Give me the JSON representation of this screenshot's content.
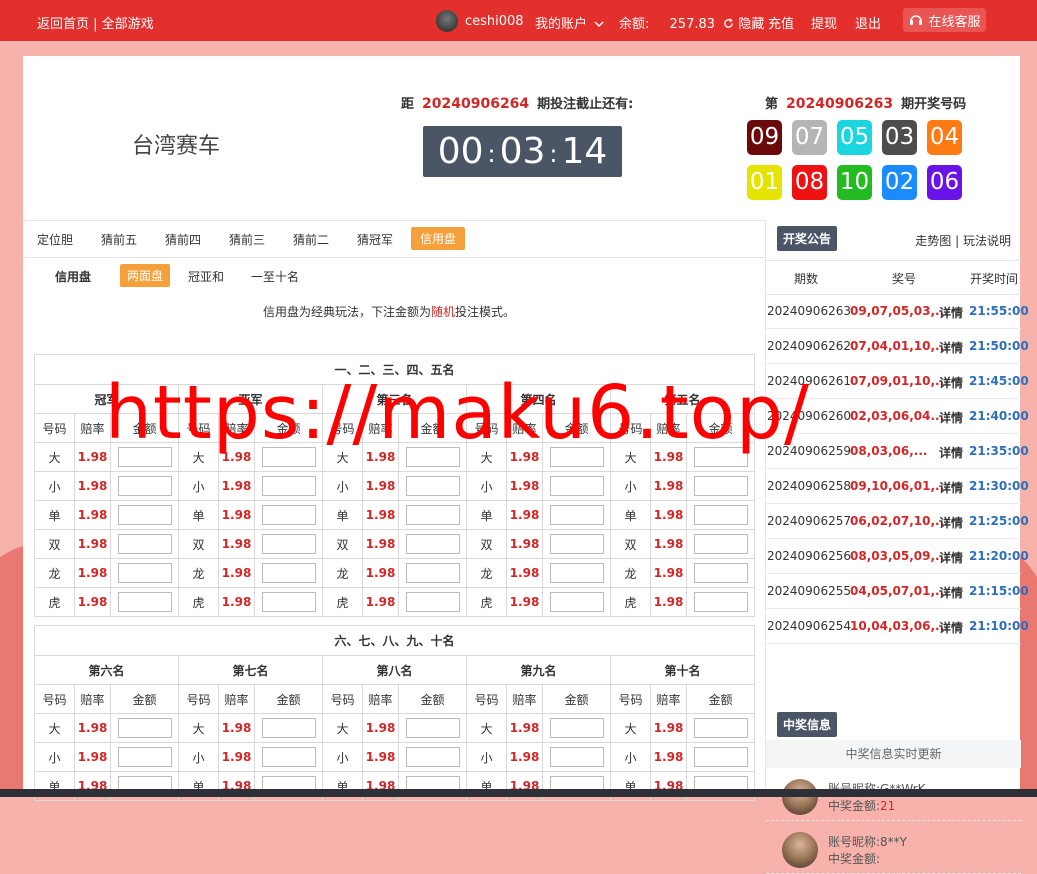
{
  "topbar": {
    "home": "返回首页",
    "sep": " | ",
    "all_games": "全部游戏",
    "username": "ceshi008",
    "account": "我的账户",
    "balance_label": "余额:",
    "balance_value": "257.83",
    "hide": "隐藏",
    "recharge": "充值",
    "withdraw": "提现",
    "logout": "退出",
    "service": "在线客服"
  },
  "header": {
    "title": "台湾赛车",
    "countdown_prefix": "距",
    "countdown_issue": "20240906264",
    "countdown_suffix": "期投注截止还有:",
    "timer": {
      "h": "00",
      "m": "03",
      "s": "14"
    },
    "draw_prefix": "第",
    "draw_issue": "20240906263",
    "draw_suffix": "期开奖号码",
    "balls": [
      {
        "n": "09",
        "color": "#6b0a0a"
      },
      {
        "n": "07",
        "color": "#b5b5b5"
      },
      {
        "n": "05",
        "color": "#1ad7df"
      },
      {
        "n": "03",
        "color": "#4d4d4d"
      },
      {
        "n": "04",
        "color": "#ff7a13"
      },
      {
        "n": "01",
        "color": "#e4e400"
      },
      {
        "n": "08",
        "color": "#ee1111"
      },
      {
        "n": "10",
        "color": "#22bb22"
      },
      {
        "n": "02",
        "color": "#1a8cff"
      },
      {
        "n": "06",
        "color": "#6a13e8"
      }
    ]
  },
  "tabs": [
    "定位胆",
    "猜前五",
    "猜前四",
    "猜前三",
    "猜前二",
    "猜冠军",
    "信用盘"
  ],
  "subtabs": [
    "信用盘",
    "两面盘",
    "冠亚和",
    "一至十名"
  ],
  "desc": {
    "pre": "信用盘为经典玩法，下注金额为",
    "red": "随机",
    "post": "投注模式。"
  },
  "section1": {
    "title": "一、二、三、四、五名",
    "positions": [
      "冠军",
      "亚军",
      "第三名",
      "第四名",
      "第五名"
    ]
  },
  "section2": {
    "title": "六、七、八、九、十名",
    "positions": [
      "第六名",
      "第七名",
      "第八名",
      "第九名",
      "第十名"
    ]
  },
  "cols": {
    "num": "号码",
    "odds": "赔率",
    "amount": "金额"
  },
  "bets": [
    "大",
    "小",
    "单",
    "双",
    "龙",
    "虎"
  ],
  "odds": "1.98",
  "right": {
    "notice": "开奖公告",
    "trend": "走势图",
    "sep": " | ",
    "rules": "玩法说明",
    "head": {
      "period": "期数",
      "prize": "奖号",
      "time": "开奖时间"
    },
    "history": [
      {
        "p": "20240906263",
        "n": "09,07,05,03,...",
        "d": "详情",
        "t": "21:55:00"
      },
      {
        "p": "20240906262",
        "n": "07,04,01,10,...",
        "d": "详情",
        "t": "21:50:00"
      },
      {
        "p": "20240906261",
        "n": "07,09,01,10,...",
        "d": "详情",
        "t": "21:45:00"
      },
      {
        "p": "20240906260",
        "n": "02,03,06,04...",
        "d": "详情",
        "t": "21:40:00"
      },
      {
        "p": "20240906259",
        "n": "08,03,06,...",
        "d": "详情",
        "t": "21:35:00"
      },
      {
        "p": "20240906258",
        "n": "09,10,06,01,...",
        "d": "详情",
        "t": "21:30:00"
      },
      {
        "p": "20240906257",
        "n": "06,02,07,10,...",
        "d": "详情",
        "t": "21:25:00"
      },
      {
        "p": "20240906256",
        "n": "08,03,05,09,...",
        "d": "详情",
        "t": "21:20:00"
      },
      {
        "p": "20240906255",
        "n": "04,05,07,01,...",
        "d": "详情",
        "t": "21:15:00"
      },
      {
        "p": "20240906254",
        "n": "10,04,03,06,...",
        "d": "详情",
        "t": "21:10:00"
      }
    ],
    "win_title": "中奖信息",
    "win_sub": "中奖信息实时更新",
    "winners": [
      {
        "name_label": "账号昵称:",
        "name": "G**WrK",
        "amt_label": "中奖金额:",
        "amt": "21"
      },
      {
        "name_label": "账号昵称:",
        "name": "8**Y",
        "amt_label": "中奖金额:",
        "amt": ""
      }
    ]
  },
  "watermark": "https://maku6.top/"
}
